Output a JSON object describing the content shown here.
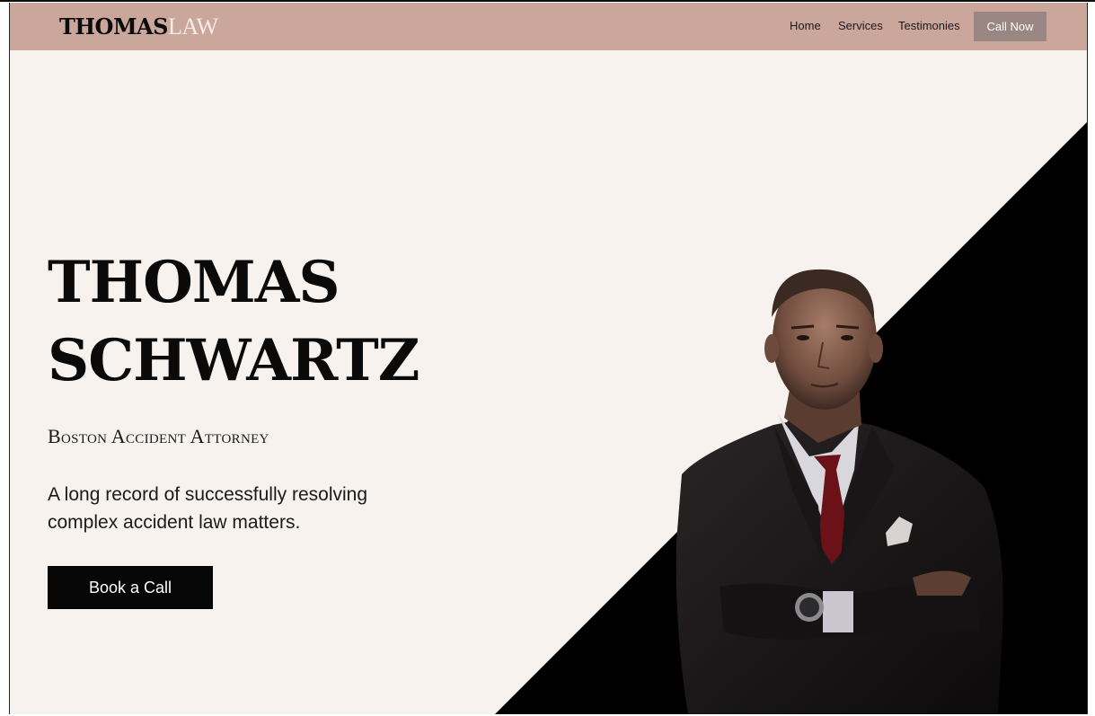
{
  "header": {
    "brand_primary": "THOMAS",
    "brand_secondary": "LAW",
    "nav": [
      {
        "label": "Home"
      },
      {
        "label": "Services"
      },
      {
        "label": "Testimonies"
      }
    ],
    "cta_label": "Call Now"
  },
  "hero": {
    "title_line1": "THOMAS",
    "title_line2": "SCHWARTZ",
    "subtitle": "Boston Accident Attorney",
    "tagline": "A long record of successfully resolving complex accident law matters.",
    "button_label": "Book a Call"
  },
  "colors": {
    "navbar": "#cba79b",
    "background": "#f7f2ed",
    "call_button": "#9a8682",
    "dark": "#060606"
  }
}
